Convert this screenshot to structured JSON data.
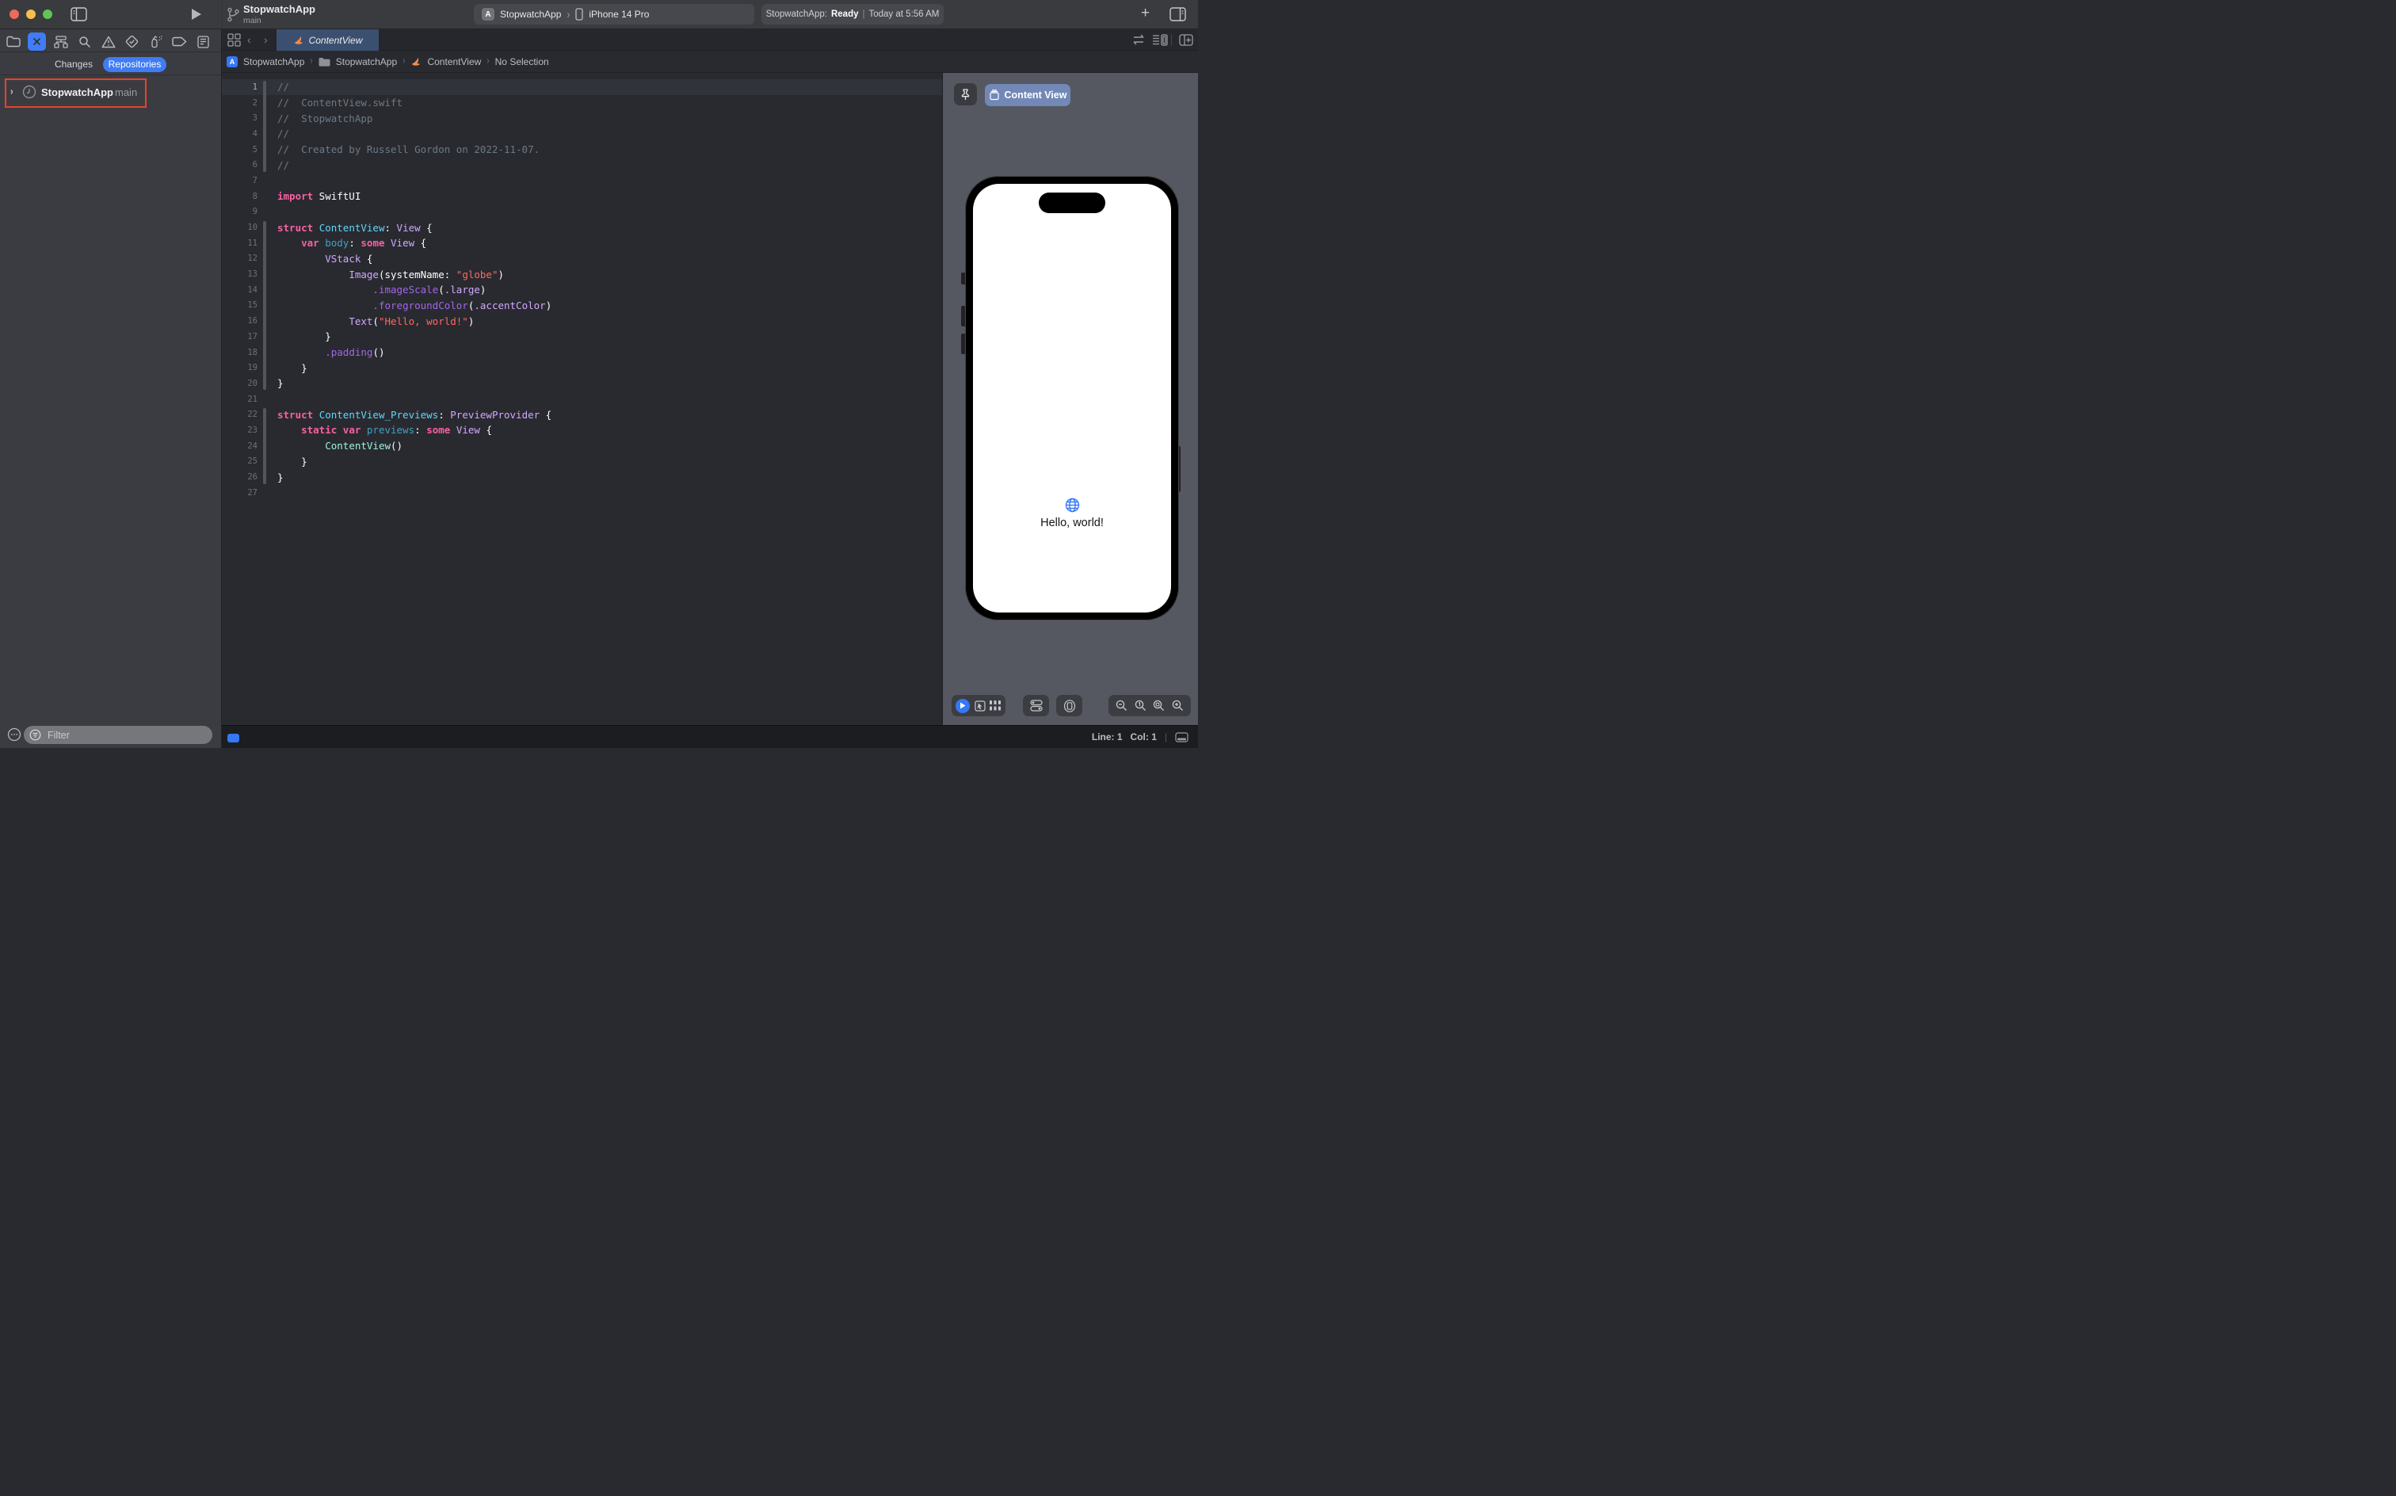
{
  "colors": {
    "accent_blue": "#3F7CF6",
    "annotation_red": "#E8432A",
    "selected_tab": "#3B5070",
    "preview_pill": "#7288B7",
    "globe_blue": "#3478F6"
  },
  "icons": {
    "chevron_separator": "›",
    "back_chevron": "‹",
    "forward_chevron": "›",
    "disclosure_chevron": "›",
    "plus": "+",
    "ellipsis": "⋯",
    "app_glyph": "A"
  },
  "window": {
    "title": "StopwatchApp",
    "branch": "main"
  },
  "scheme": {
    "target": "StopwatchApp",
    "device": "iPhone 14 Pro"
  },
  "status": {
    "app_label": "StopwatchApp:",
    "state": "Ready",
    "sep": "|",
    "time": "Today at 5:56 AM"
  },
  "sidebar": {
    "segments": [
      {
        "label": "Changes"
      },
      {
        "label": "Repositories"
      }
    ],
    "repo": {
      "name": "StopwatchApp",
      "branch": "main"
    },
    "filter_placeholder": "Filter"
  },
  "editor": {
    "tab_label": "ContentView",
    "breadcrumb": [
      {
        "label": "StopwatchApp"
      },
      {
        "label": "StopwatchApp"
      },
      {
        "label": "ContentView"
      },
      {
        "label": "No Selection"
      }
    ],
    "code": {
      "current_line": 1,
      "colors": {
        "comment": "#6C7986",
        "keyword": "#FC5FA3",
        "string": "#FC6A5D",
        "typeDecl": "#5DD8FF",
        "propDecl": "#41A1C0",
        "type": "#D0A8FF",
        "method": "#A167E6",
        "property": "#D0A8FF",
        "project": "#9EF1DD",
        "plain": "#FFFFFF"
      },
      "changed_ranges": [
        [
          1,
          6
        ],
        [
          10,
          20
        ],
        [
          22,
          26
        ]
      ],
      "lines": [
        {
          "n": 1,
          "t": [
            [
              "comment",
              "//"
            ]
          ]
        },
        {
          "n": 2,
          "t": [
            [
              "comment",
              "//  ContentView.swift"
            ]
          ]
        },
        {
          "n": 3,
          "t": [
            [
              "comment",
              "//  StopwatchApp"
            ]
          ]
        },
        {
          "n": 4,
          "t": [
            [
              "comment",
              "//"
            ]
          ]
        },
        {
          "n": 5,
          "t": [
            [
              "comment",
              "//  Created by Russell Gordon on 2022-11-07."
            ]
          ]
        },
        {
          "n": 6,
          "t": [
            [
              "comment",
              "//"
            ]
          ]
        },
        {
          "n": 7,
          "t": []
        },
        {
          "n": 8,
          "t": [
            [
              "keyword",
              "import"
            ],
            [
              "plain",
              " SwiftUI"
            ]
          ]
        },
        {
          "n": 9,
          "t": []
        },
        {
          "n": 10,
          "t": [
            [
              "keyword",
              "struct"
            ],
            [
              "plain",
              " "
            ],
            [
              "typeDecl",
              "ContentView"
            ],
            [
              "plain",
              ": "
            ],
            [
              "type",
              "View"
            ],
            [
              "plain",
              " {"
            ]
          ]
        },
        {
          "n": 11,
          "t": [
            [
              "plain",
              "    "
            ],
            [
              "keyword",
              "var"
            ],
            [
              "plain",
              " "
            ],
            [
              "propDecl",
              "body"
            ],
            [
              "plain",
              ": "
            ],
            [
              "keyword",
              "some"
            ],
            [
              "plain",
              " "
            ],
            [
              "type",
              "View"
            ],
            [
              "plain",
              " {"
            ]
          ]
        },
        {
          "n": 12,
          "t": [
            [
              "plain",
              "        "
            ],
            [
              "type",
              "VStack"
            ],
            [
              "plain",
              " {"
            ]
          ]
        },
        {
          "n": 13,
          "t": [
            [
              "plain",
              "            "
            ],
            [
              "type",
              "Image"
            ],
            [
              "plain",
              "(systemName: "
            ],
            [
              "string",
              "\"globe\""
            ],
            [
              "plain",
              ")"
            ]
          ]
        },
        {
          "n": 14,
          "t": [
            [
              "plain",
              "                "
            ],
            [
              "method",
              ".imageScale"
            ],
            [
              "plain",
              "("
            ],
            [
              "property",
              ".large"
            ],
            [
              "plain",
              ")"
            ]
          ]
        },
        {
          "n": 15,
          "t": [
            [
              "plain",
              "                "
            ],
            [
              "method",
              ".foregroundColor"
            ],
            [
              "plain",
              "("
            ],
            [
              "property",
              ".accentColor"
            ],
            [
              "plain",
              ")"
            ]
          ]
        },
        {
          "n": 16,
          "t": [
            [
              "plain",
              "            "
            ],
            [
              "type",
              "Text"
            ],
            [
              "plain",
              "("
            ],
            [
              "string",
              "\"Hello, world!\""
            ],
            [
              "plain",
              ")"
            ]
          ]
        },
        {
          "n": 17,
          "t": [
            [
              "plain",
              "        }"
            ]
          ]
        },
        {
          "n": 18,
          "t": [
            [
              "plain",
              "        "
            ],
            [
              "method",
              ".padding"
            ],
            [
              "plain",
              "()"
            ]
          ]
        },
        {
          "n": 19,
          "t": [
            [
              "plain",
              "    }"
            ]
          ]
        },
        {
          "n": 20,
          "t": [
            [
              "plain",
              "}"
            ]
          ]
        },
        {
          "n": 21,
          "t": []
        },
        {
          "n": 22,
          "t": [
            [
              "keyword",
              "struct"
            ],
            [
              "plain",
              " "
            ],
            [
              "typeDecl",
              "ContentView_Previews"
            ],
            [
              "plain",
              ": "
            ],
            [
              "type",
              "PreviewProvider"
            ],
            [
              "plain",
              " {"
            ]
          ]
        },
        {
          "n": 23,
          "t": [
            [
              "plain",
              "    "
            ],
            [
              "keyword",
              "static"
            ],
            [
              "plain",
              " "
            ],
            [
              "keyword",
              "var"
            ],
            [
              "plain",
              " "
            ],
            [
              "propDecl",
              "previews"
            ],
            [
              "plain",
              ": "
            ],
            [
              "keyword",
              "some"
            ],
            [
              "plain",
              " "
            ],
            [
              "type",
              "View"
            ],
            [
              "plain",
              " {"
            ]
          ]
        },
        {
          "n": 24,
          "t": [
            [
              "plain",
              "        "
            ],
            [
              "project",
              "ContentView"
            ],
            [
              "plain",
              "()"
            ]
          ]
        },
        {
          "n": 25,
          "t": [
            [
              "plain",
              "    }"
            ]
          ]
        },
        {
          "n": 26,
          "t": [
            [
              "plain",
              "}"
            ]
          ]
        },
        {
          "n": 27,
          "t": []
        }
      ]
    }
  },
  "preview": {
    "button_label": "Content View",
    "phone_text": "Hello, world!"
  },
  "statusbar": {
    "line": "Line: 1",
    "col": "Col: 1",
    "sep": "|"
  }
}
